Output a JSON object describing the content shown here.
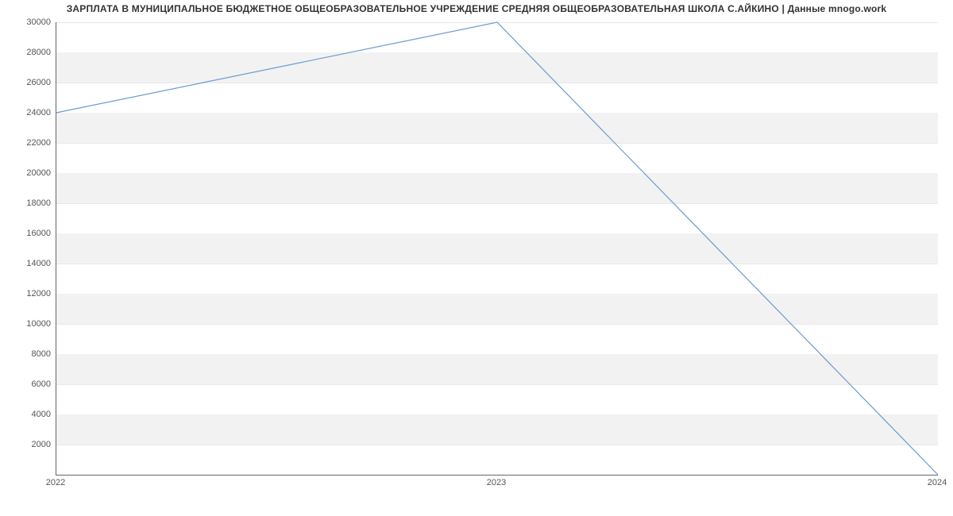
{
  "chart_data": {
    "type": "line",
    "title": "ЗАРПЛАТА В МУНИЦИПАЛЬНОЕ БЮДЖЕТНОЕ ОБЩЕОБРАЗОВАТЕЛЬНОЕ УЧРЕЖДЕНИЕ СРЕДНЯЯ ОБЩЕОБРАЗОВАТЕЛЬНАЯ ШКОЛА С.АЙКИНО | Данные mnogo.work",
    "xlabel": "",
    "ylabel": "",
    "categories": [
      "2022",
      "2023",
      "2024"
    ],
    "x": [
      2022,
      2023,
      2024
    ],
    "values": [
      24000,
      30000,
      0
    ],
    "ylim": [
      0,
      30000
    ],
    "y_ticks": [
      2000,
      4000,
      6000,
      8000,
      10000,
      12000,
      14000,
      16000,
      18000,
      20000,
      22000,
      24000,
      26000,
      28000,
      30000
    ],
    "x_ticks": [
      "2022",
      "2023",
      "2024"
    ]
  },
  "colors": {
    "line": "#6b9bd1",
    "band": "#f2f2f2"
  }
}
